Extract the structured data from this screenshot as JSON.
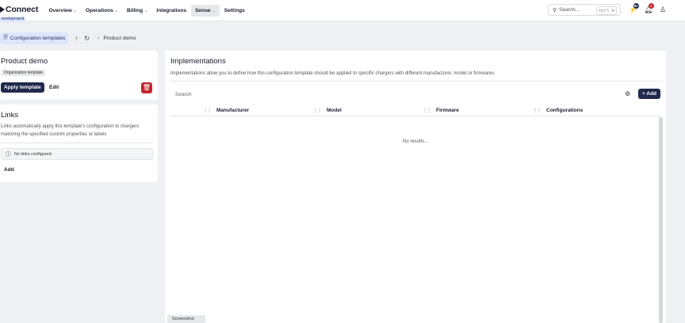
{
  "app": {
    "name": "Connect",
    "environment": "Development",
    "environment_visible": "evelopment"
  },
  "nav": {
    "items": [
      {
        "label": "Overview",
        "has_menu": true
      },
      {
        "label": "Operations",
        "has_menu": true
      },
      {
        "label": "Billing",
        "has_menu": true
      },
      {
        "label": "Integrations",
        "has_menu": false
      },
      {
        "label": "Sense",
        "has_menu": true,
        "active": true
      },
      {
        "label": "Settings",
        "has_menu": false
      }
    ],
    "search": {
      "placeholder": "Search...",
      "shortcut": "Ctrl K"
    },
    "activity_count": "9+",
    "notification_count": "1"
  },
  "breadcrumb": {
    "parent": "Configuration templates",
    "current": "Product demo"
  },
  "template": {
    "title": "Product demo",
    "badge": "Organization template",
    "apply_label": "Apply template",
    "edit_label": "Edit"
  },
  "links": {
    "title": "Links",
    "description": "Links automatically apply this template's configuration to chargers matching the specified custom properties or labels",
    "empty_message": "No links configured",
    "add_label": "Add"
  },
  "implementations": {
    "title": "Implementations",
    "description": "Implementations allow you to define how this configuration template should be applied to specific chargers with different manufacturer, model or firmwares",
    "search_placeholder": "Search",
    "add_label": "Add",
    "columns": [
      "Manufacturer",
      "Model",
      "Firmware",
      "Configurations"
    ],
    "empty_message": "No results..."
  },
  "footer": {
    "tab_label": "Screenshot"
  },
  "colors": {
    "primary": "#1f2a4d",
    "danger": "#c4252c",
    "badge_bg": "#dde6ff",
    "page_bg": "#eef0f3"
  }
}
